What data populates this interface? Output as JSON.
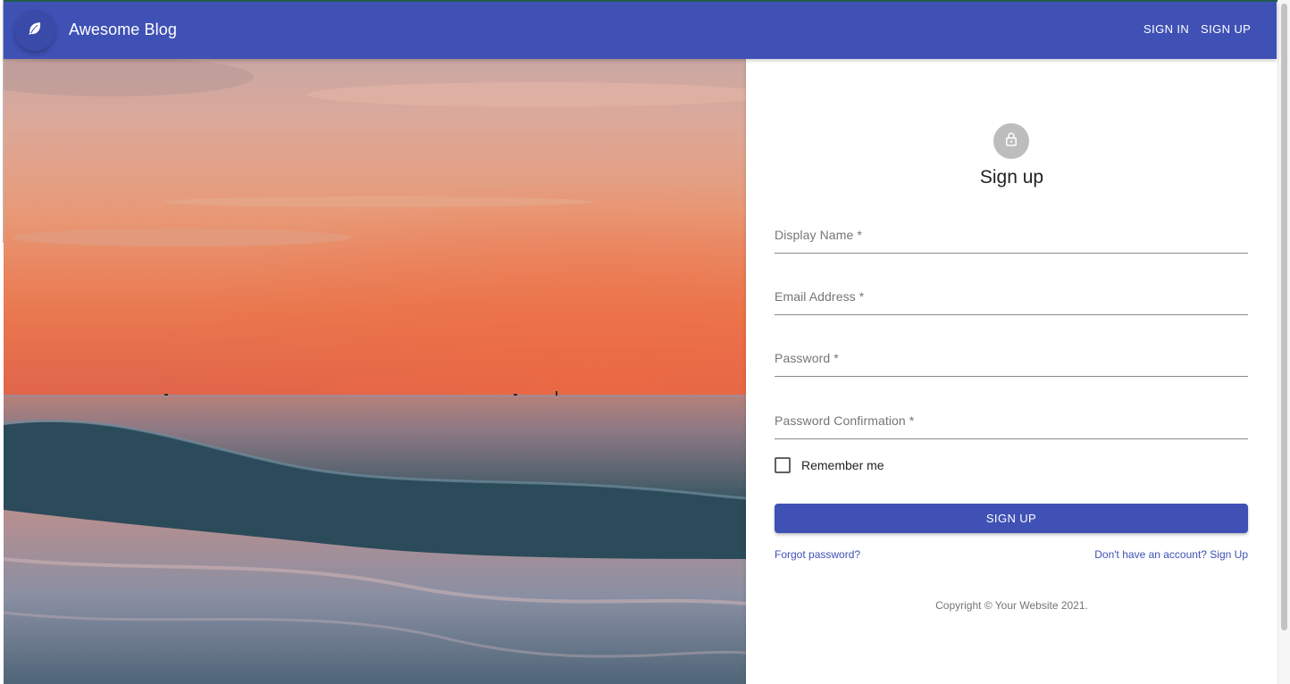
{
  "appbar": {
    "brand": "Awesome Blog",
    "logo_icon": "leaf-icon",
    "nav": {
      "sign_in": "SIGN IN",
      "sign_up": "SIGN UP"
    },
    "color": "#3f51b5"
  },
  "hero": {
    "icon": "sunset-ocean-photo"
  },
  "form": {
    "avatar_icon": "lock-icon",
    "title": "Sign up",
    "fields": {
      "display_name": "Display Name *",
      "email": "Email Address *",
      "password": "Password *",
      "password_confirmation": "Password Confirmation *"
    },
    "remember_me": "Remember me",
    "submit": "SIGN UP",
    "forgot_password": "Forgot password?",
    "signup_link": "Don't have an account? Sign Up",
    "copyright": "Copyright © Your Website 2021."
  }
}
